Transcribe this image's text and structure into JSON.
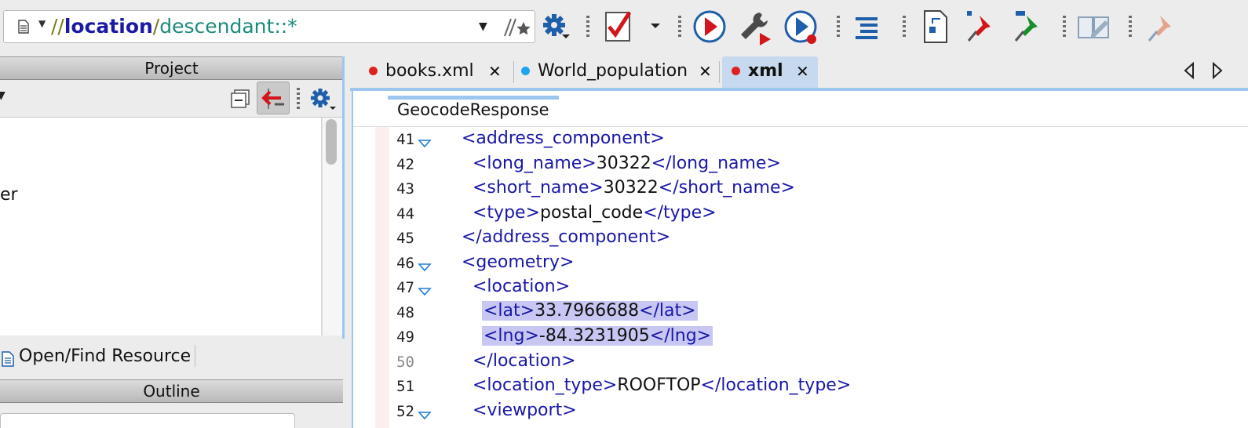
{
  "toolbar": {
    "xpath": {
      "slashes": "//",
      "keyword": "location",
      "sep": "/",
      "axis": "descendant::",
      "star": "*"
    },
    "icons": [
      "document-icon",
      "xpath-settings-icon",
      "validate-icon",
      "run-transform-icon",
      "configure-transform-icon",
      "debug-transform-icon",
      "format-indent-icon",
      "xslt-debugger-icon",
      "pin-red-icon",
      "pin-green-icon",
      "edit-book-icon",
      "pin-disabled-icon"
    ]
  },
  "project_panel": {
    "title": "Project",
    "tree_text": "er"
  },
  "open_find": {
    "label": "Open/Find Resource"
  },
  "outline_panel": {
    "title": "Outline"
  },
  "tabs": [
    {
      "label": "books.xml",
      "dot_color": "#e02020",
      "active": false
    },
    {
      "label": "World_population",
      "dot_color": "#1fa3f0",
      "active": false
    },
    {
      "label": "xml",
      "dot_color": "#e02020",
      "active": true
    }
  ],
  "breadcrumb": "GeocodeResponse",
  "code_lines": [
    {
      "n": "41",
      "fold": true
    },
    {
      "n": "42",
      "fold": false
    },
    {
      "n": "43",
      "fold": false
    },
    {
      "n": "44",
      "fold": false
    },
    {
      "n": "45",
      "fold": false
    },
    {
      "n": "46",
      "fold": true
    },
    {
      "n": "47",
      "fold": true
    },
    {
      "n": "48",
      "fold": false
    },
    {
      "n": "49",
      "fold": false
    },
    {
      "n": "50",
      "fold": false
    },
    {
      "n": "51",
      "fold": false
    },
    {
      "n": "52",
      "fold": true
    }
  ],
  "code": {
    "l41_open": "<address_component>",
    "l42_open": "<long_name>",
    "l42_val": "30322",
    "l42_close": "</long_name>",
    "l43_open": "<short_name>",
    "l43_val": "30322",
    "l43_close": "</short_name>",
    "l44_open": "<type>",
    "l44_val": "postal_code",
    "l44_close": "</type>",
    "l45_close": "</address_component>",
    "l46_open": "<geometry>",
    "l47_open": "<location>",
    "l48_open": "<lat>",
    "l48_val": "33.7966688",
    "l48_close": "</lat>",
    "l49_open": "<lng>",
    "l49_val": "-84.3231905",
    "l49_close": "</lng>",
    "l50_close": "</location>",
    "l51_open": "<location_type>",
    "l51_val": "ROOFTOP",
    "l51_close": "</location_type>",
    "l52_open": "<viewport>"
  },
  "colors": {
    "tag": "#1818a8",
    "highlight": "#c8c6f2",
    "active_tab": "#c7d9ef",
    "accent": "#9cc6ee"
  }
}
